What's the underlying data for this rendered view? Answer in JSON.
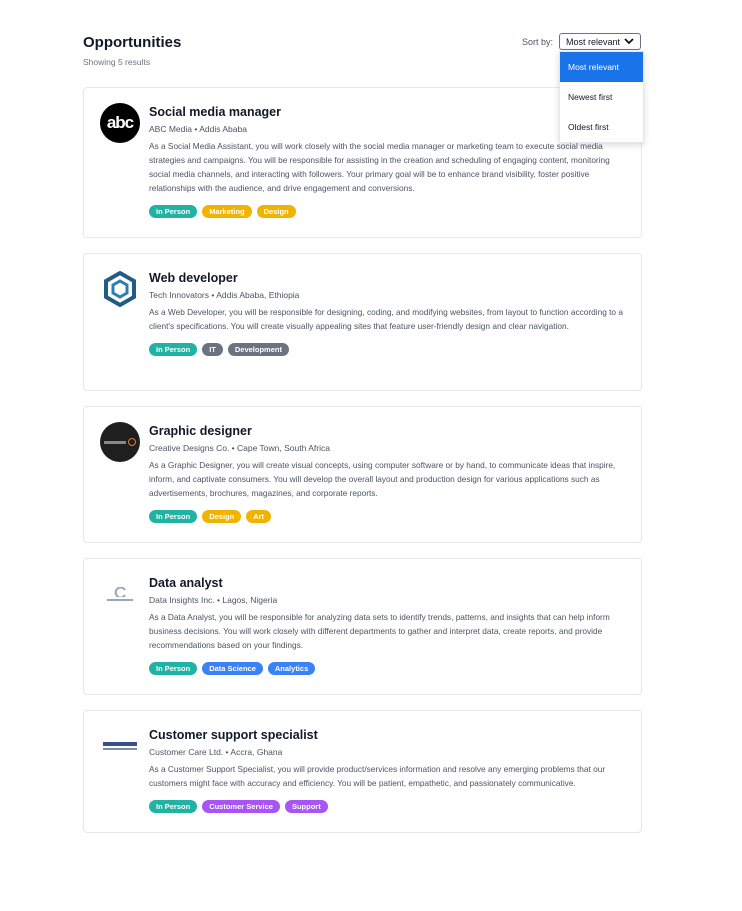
{
  "header": {
    "title": "Opportunities",
    "results": "Showing 5 results"
  },
  "sort": {
    "label": "Sort by:",
    "selected": "Most relevant",
    "options": [
      "Most relevant",
      "Newest first",
      "Oldest first"
    ]
  },
  "jobs": [
    {
      "title": "Social media manager",
      "meta": "ABC Media • Addis Ababa",
      "logo": "abc-logo",
      "description": "As a Social Media Assistant, you will work closely with the social media manager or marketing team to execute social media strategies and campaigns. You will be responsible for assisting in the creation and scheduling of engaging content, monitoring social media channels, and interacting with followers. Your primary goal will be to enhance brand visibility, foster positive relationships with the audience, and drive engagement and conversions.",
      "tags": [
        {
          "label": "In Person",
          "color": "#20b2a2"
        },
        {
          "label": "Marketing",
          "color": "#f0b400"
        },
        {
          "label": "Design",
          "color": "#f0b400"
        }
      ]
    },
    {
      "title": "Web developer",
      "meta": "Tech Innovators • Addis Ababa, Ethiopia",
      "logo": "hexagon-logo",
      "description": "As a Web Developer, you will be responsible for designing, coding, and modifying websites, from layout to function according to a client's specifications. You will create visually appealing sites that feature user-friendly design and clear navigation.",
      "tags": [
        {
          "label": "In Person",
          "color": "#20b2a2"
        },
        {
          "label": "IT",
          "color": "#6b7280"
        },
        {
          "label": "Development",
          "color": "#6b7280"
        }
      ]
    },
    {
      "title": "Graphic designer",
      "meta": "Creative Designs Co. • Cape Town, South Africa",
      "logo": "dark-circle-logo",
      "description": "As a Graphic Designer, you will create visual concepts, using computer software or by hand, to communicate ideas that inspire, inform, and captivate consumers. You will develop the overall layout and production design for various applications such as advertisements, brochures, magazines, and corporate reports.",
      "tags": [
        {
          "label": "In Person",
          "color": "#20b2a2"
        },
        {
          "label": "Design",
          "color": "#f0b400"
        },
        {
          "label": "Art",
          "color": "#f0b400"
        }
      ]
    },
    {
      "title": "Data analyst",
      "meta": "Data Insights Inc. • Lagos, Nigeria",
      "logo": "data-insights-logo",
      "description": "As a Data Analyst, you will be responsible for analyzing data sets to identify trends, patterns, and insights that can help inform business decisions. You will work closely with different departments to gather and interpret data, create reports, and provide recommendations based on your findings.",
      "tags": [
        {
          "label": "In Person",
          "color": "#20b2a2"
        },
        {
          "label": "Data Science",
          "color": "#3b82f6"
        },
        {
          "label": "Analytics",
          "color": "#3b82f6"
        }
      ]
    },
    {
      "title": "Customer support specialist",
      "meta": "Customer Care Ltd. • Accra, Ghana",
      "logo": "customer-care-logo",
      "description": "As a Customer Support Specialist, you will provide product/services information and resolve any emerging problems that our customers might face with accuracy and efficiency. You will be patient, empathetic, and passionately communicative.",
      "tags": [
        {
          "label": "In Person",
          "color": "#20b2a2"
        },
        {
          "label": "Customer Service",
          "color": "#a855f7"
        },
        {
          "label": "Support",
          "color": "#a855f7"
        }
      ]
    }
  ]
}
